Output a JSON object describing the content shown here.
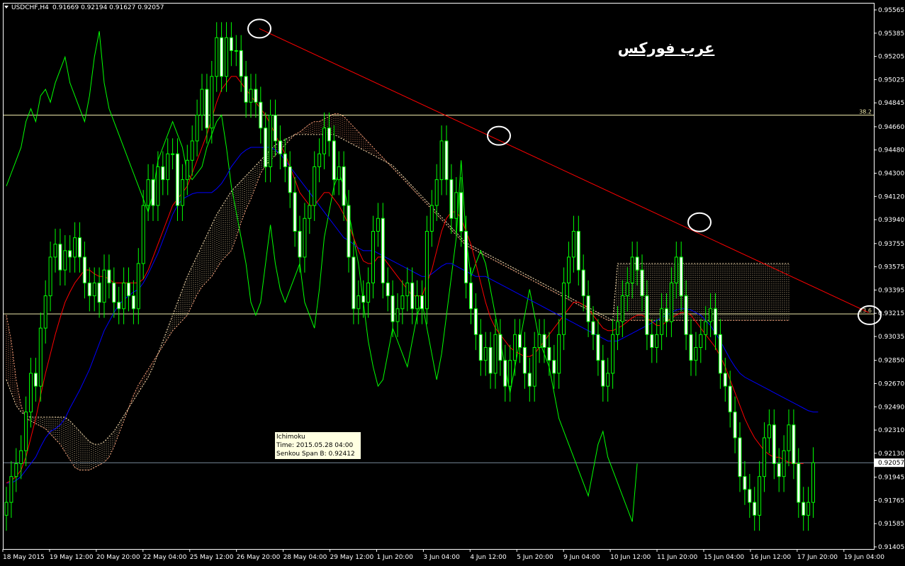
{
  "header": {
    "symbol_label": "USDCHF,H4",
    "ohlc": "0.91669 0.92194 0.91627 0.92057"
  },
  "brand_text": "عرب فوركس",
  "tooltip": {
    "title": "Ichimoku",
    "time_line": "Time: 2015.05.28 04:00",
    "value_line": "Senkou Span B: 0.92412"
  },
  "colors": {
    "background": "#000000",
    "frame": "#ffffff",
    "candles": "#00ff00",
    "tenkan": "#ff0000",
    "kijun": "#0000ff",
    "chikou": "#00ff00",
    "cloud_a": "#ffa07a",
    "cloud_b": "#ffe4b5",
    "trendline": "#ff0000",
    "fib_levels": "#eee8aa",
    "current_price_line": "#778899",
    "circles": "#ffffff"
  },
  "chart_data": {
    "type": "candlestick",
    "symbol": "USDCHF",
    "timeframe": "H4",
    "ohlc_last": {
      "open": 0.91669,
      "high": 0.92194,
      "low": 0.91627,
      "close": 0.92057
    },
    "current_price": 0.92057,
    "yticks": [
      "0.95565",
      "0.95385",
      "0.95205",
      "0.95025",
      "0.94845",
      "0.94660",
      "0.94480",
      "0.94300",
      "0.94120",
      "0.93940",
      "0.93755",
      "0.93575",
      "0.93395",
      "0.93215",
      "0.93035",
      "0.92850",
      "0.92670",
      "0.92490",
      "0.92310",
      "0.92130",
      "0.91945",
      "0.91765",
      "0.91585",
      "0.91405"
    ],
    "ylim": [
      0.91405,
      0.95565
    ],
    "xticks": [
      "18 May 2015",
      "19 May 12:00",
      "20 May 20:00",
      "22 May 04:00",
      "25 May 12:00",
      "26 May 20:00",
      "28 May 04:00",
      "29 May 12:00",
      "1 Jun 20:00",
      "3 Jun 04:00",
      "4 Jun 12:00",
      "5 Jun 20:00",
      "9 Jun 04:00",
      "10 Jun 12:00",
      "11 Jun 20:00",
      "15 Jun 04:00",
      "16 Jun 12:00",
      "17 Jun 20:00",
      "19 Jun 04:00"
    ],
    "fib_levels": [
      {
        "label": "38.2",
        "price": 0.9475
      },
      {
        "label": "23.6",
        "price": 0.9321
      }
    ],
    "indicators": [
      "Ichimoku",
      "Tenkan-sen",
      "Kijun-sen",
      "Chikou Span",
      "Senkou Span A",
      "Senkou Span B"
    ],
    "annotations": [
      "trendline",
      "touch circles"
    ],
    "series": {
      "close": [
        0.9175,
        0.9195,
        0.9205,
        0.9215,
        0.9245,
        0.9275,
        0.9265,
        0.931,
        0.9335,
        0.9365,
        0.9375,
        0.9355,
        0.937,
        0.9365,
        0.938,
        0.9365,
        0.9345,
        0.9335,
        0.9345,
        0.933,
        0.9355,
        0.9345,
        0.933,
        0.9325,
        0.9345,
        0.9335,
        0.9325,
        0.936,
        0.9405,
        0.9425,
        0.9405,
        0.9435,
        0.9425,
        0.9445,
        0.9445,
        0.9405,
        0.9425,
        0.944,
        0.9455,
        0.9475,
        0.9495,
        0.9465,
        0.9505,
        0.9535,
        0.9505,
        0.9535,
        0.9525,
        0.9525,
        0.9505,
        0.9485,
        0.9495,
        0.9485,
        0.9465,
        0.9435,
        0.9475,
        0.9455,
        0.9445,
        0.9435,
        0.9415,
        0.9385,
        0.9365,
        0.9395,
        0.9405,
        0.9435,
        0.9445,
        0.9465,
        0.9455,
        0.9425,
        0.9435,
        0.9405,
        0.9365,
        0.9325,
        0.9335,
        0.933,
        0.9345,
        0.9385,
        0.9395,
        0.9345,
        0.9335,
        0.9315,
        0.9325,
        0.9335,
        0.9345,
        0.9325,
        0.9335,
        0.9325,
        0.9385,
        0.9405,
        0.9425,
        0.9455,
        0.9425,
        0.9395,
        0.9415,
        0.9385,
        0.9345,
        0.9325,
        0.9305,
        0.9285,
        0.9295,
        0.9275,
        0.9305,
        0.9285,
        0.9265,
        0.9285,
        0.9305,
        0.9295,
        0.9275,
        0.9265,
        0.9295,
        0.9305,
        0.9295,
        0.9285,
        0.9275,
        0.9305,
        0.9345,
        0.9365,
        0.9385,
        0.9355,
        0.9335,
        0.9315,
        0.9305,
        0.9285,
        0.9265,
        0.9275,
        0.9305,
        0.9315,
        0.9335,
        0.9345,
        0.9365,
        0.9355,
        0.9335,
        0.9305,
        0.9295,
        0.9305,
        0.9325,
        0.9315,
        0.9345,
        0.9365,
        0.9335,
        0.9305,
        0.9285,
        0.9295,
        0.9305,
        0.9315,
        0.9325,
        0.9305,
        0.9275,
        0.9265,
        0.9245,
        0.9225,
        0.9195,
        0.9185,
        0.9175,
        0.9165,
        0.9195,
        0.9225,
        0.9235,
        0.9205,
        0.9195,
        0.9215,
        0.9235,
        0.9205,
        0.9175,
        0.9165,
        0.9175,
        0.92057
      ],
      "tenkan": [
        0.919,
        0.9192,
        0.9195,
        0.92,
        0.921,
        0.9225,
        0.924,
        0.9258,
        0.9275,
        0.929,
        0.9305,
        0.9318,
        0.933,
        0.9338,
        0.9345,
        0.935,
        0.9355,
        0.9355,
        0.9352,
        0.935,
        0.935,
        0.9348,
        0.9345,
        0.9345,
        0.9345,
        0.9345,
        0.9345,
        0.9345,
        0.9348,
        0.9355,
        0.9365,
        0.9375,
        0.9385,
        0.9395,
        0.9405,
        0.941,
        0.9415,
        0.942,
        0.943,
        0.944,
        0.945,
        0.946,
        0.9472,
        0.9485,
        0.9495,
        0.95,
        0.9505,
        0.9505,
        0.95,
        0.9495,
        0.949,
        0.9485,
        0.948,
        0.9475,
        0.9468,
        0.946,
        0.9452,
        0.9445,
        0.9435,
        0.9425,
        0.9415,
        0.941,
        0.9405,
        0.9405,
        0.941,
        0.9415,
        0.9415,
        0.941,
        0.9405,
        0.9398,
        0.939,
        0.938,
        0.937,
        0.9362,
        0.936,
        0.936,
        0.9365,
        0.9365,
        0.936,
        0.9355,
        0.935,
        0.9345,
        0.934,
        0.9335,
        0.9335,
        0.9335,
        0.9345,
        0.9355,
        0.937,
        0.9385,
        0.9395,
        0.94,
        0.94,
        0.9395,
        0.9385,
        0.9375,
        0.936,
        0.9345,
        0.933,
        0.9318,
        0.931,
        0.9305,
        0.93,
        0.9295,
        0.9292,
        0.929,
        0.9288,
        0.9288,
        0.929,
        0.9295,
        0.93,
        0.9305,
        0.931,
        0.9315,
        0.932,
        0.9325,
        0.933,
        0.933,
        0.9328,
        0.9325,
        0.932,
        0.9315,
        0.931,
        0.9308,
        0.9308,
        0.931,
        0.9312,
        0.9315,
        0.9318,
        0.932,
        0.932,
        0.9318,
        0.9315,
        0.9312,
        0.9312,
        0.9315,
        0.9318,
        0.932,
        0.9322,
        0.9322,
        0.932,
        0.9315,
        0.931,
        0.9305,
        0.93,
        0.9295,
        0.9288,
        0.928,
        0.927,
        0.926,
        0.925,
        0.924,
        0.9232,
        0.9225,
        0.922,
        0.9215,
        0.9212,
        0.921,
        0.921,
        0.9208,
        0.9206,
        0.9205,
        0.9205,
        0.9205
      ],
      "kijun": [
        0.919,
        0.919,
        0.9192,
        0.9195,
        0.92,
        0.9205,
        0.921,
        0.9218,
        0.9225,
        0.923,
        0.9232,
        0.9235,
        0.924,
        0.9248,
        0.9255,
        0.9262,
        0.927,
        0.9278,
        0.9288,
        0.9298,
        0.9308,
        0.9315,
        0.9322,
        0.9328,
        0.9332,
        0.9335,
        0.9338,
        0.934,
        0.9345,
        0.9352,
        0.936,
        0.9368,
        0.9378,
        0.9388,
        0.9398,
        0.9405,
        0.941,
        0.9412,
        0.9414,
        0.9415,
        0.9415,
        0.9415,
        0.9415,
        0.9418,
        0.9422,
        0.9428,
        0.9435,
        0.944,
        0.9445,
        0.9448,
        0.945,
        0.945,
        0.945,
        0.945,
        0.945,
        0.9448,
        0.9445,
        0.944,
        0.9435,
        0.943,
        0.9425,
        0.942,
        0.9415,
        0.941,
        0.9405,
        0.94,
        0.9395,
        0.939,
        0.9385,
        0.938,
        0.9378,
        0.9375,
        0.9372,
        0.937,
        0.937,
        0.937,
        0.9368,
        0.9366,
        0.9364,
        0.9362,
        0.936,
        0.9358,
        0.9356,
        0.9354,
        0.9352,
        0.935,
        0.935,
        0.9352,
        0.9355,
        0.9358,
        0.936,
        0.936,
        0.9358,
        0.9356,
        0.9354,
        0.9352,
        0.935,
        0.935,
        0.935,
        0.9348,
        0.9346,
        0.9344,
        0.9342,
        0.934,
        0.9338,
        0.9336,
        0.9334,
        0.9332,
        0.933,
        0.9328,
        0.9326,
        0.9324,
        0.9322,
        0.932,
        0.9318,
        0.9316,
        0.9314,
        0.9312,
        0.931,
        0.9308,
        0.9306,
        0.9304,
        0.9302,
        0.93,
        0.93,
        0.93,
        0.9302,
        0.9304,
        0.9306,
        0.9308,
        0.931,
        0.9312,
        0.9314,
        0.9316,
        0.9318,
        0.932,
        0.9322,
        0.9324,
        0.9325,
        0.9325,
        0.9324,
        0.9322,
        0.932,
        0.9316,
        0.9312,
        0.9306,
        0.93,
        0.9293,
        0.9286,
        0.928,
        0.9275,
        0.9272,
        0.927,
        0.9268,
        0.9266,
        0.9264,
        0.9262,
        0.926,
        0.9258,
        0.9256,
        0.9254,
        0.9252,
        0.925,
        0.9248,
        0.9246,
        0.9245,
        0.9245
      ],
      "chikou": [
        0.942,
        0.943,
        0.944,
        0.945,
        0.947,
        0.948,
        0.947,
        0.949,
        0.9495,
        0.9485,
        0.95,
        0.951,
        0.952,
        0.95,
        0.949,
        0.948,
        0.947,
        0.949,
        0.952,
        0.954,
        0.95,
        0.948,
        0.947,
        0.946,
        0.945,
        0.944,
        0.943,
        0.942,
        0.941,
        0.94,
        0.9415,
        0.944,
        0.945,
        0.946,
        0.947,
        0.946,
        0.945,
        0.943,
        0.9425,
        0.943,
        0.9435,
        0.945,
        0.946,
        0.947,
        0.9475,
        0.945,
        0.942,
        0.94,
        0.938,
        0.936,
        0.933,
        0.932,
        0.933,
        0.936,
        0.939,
        0.936,
        0.934,
        0.933,
        0.934,
        0.935,
        0.936,
        0.933,
        0.932,
        0.931,
        0.934,
        0.938,
        0.94,
        0.942,
        0.943,
        0.942,
        0.94,
        0.938,
        0.936,
        0.933,
        0.93,
        0.928,
        0.9265,
        0.927,
        0.929,
        0.931,
        0.93,
        0.929,
        0.928,
        0.93,
        0.932,
        0.933,
        0.931,
        0.929,
        0.927,
        0.929,
        0.932,
        0.935,
        0.938,
        0.944,
        0.938,
        0.935,
        0.936,
        0.937,
        0.936,
        0.934,
        0.932,
        0.93,
        0.928,
        0.926,
        0.928,
        0.93,
        0.932,
        0.934,
        0.932,
        0.93,
        0.929,
        0.928,
        0.926,
        0.924,
        0.923,
        0.922,
        0.921,
        0.92,
        0.919,
        0.918,
        0.92,
        0.922,
        0.923,
        0.921,
        0.92,
        0.919,
        0.918,
        0.917,
        0.916,
        0.9205
      ],
      "senkou_a": [
        0.932,
        0.93,
        0.927,
        0.925,
        0.924,
        0.9238,
        0.9236,
        0.9234,
        0.9232,
        0.9228,
        0.9224,
        0.922,
        0.9214,
        0.9208,
        0.9202,
        0.92,
        0.92,
        0.92,
        0.9202,
        0.9204,
        0.9206,
        0.921,
        0.9218,
        0.9228,
        0.9238,
        0.9248,
        0.9258,
        0.9266,
        0.9272,
        0.9278,
        0.9284,
        0.929,
        0.9296,
        0.9302,
        0.9308,
        0.9312,
        0.9316,
        0.932,
        0.9328,
        0.9336,
        0.9342,
        0.9346,
        0.935,
        0.9356,
        0.9362,
        0.9366,
        0.937,
        0.938,
        0.9392,
        0.9402,
        0.941,
        0.942,
        0.943,
        0.9436,
        0.944,
        0.9444,
        0.9448,
        0.9452,
        0.9456,
        0.946,
        0.9462,
        0.9465,
        0.9468,
        0.947,
        0.947,
        0.9472,
        0.9474,
        0.9476,
        0.9476,
        0.9474,
        0.947,
        0.9466,
        0.9462,
        0.9458,
        0.9454,
        0.945,
        0.9446,
        0.9442,
        0.9438,
        0.9434,
        0.943,
        0.9426,
        0.9422,
        0.9418,
        0.9414,
        0.941,
        0.9406,
        0.9402,
        0.9398,
        0.9394,
        0.939,
        0.9386,
        0.9382,
        0.9378,
        0.9374,
        0.9372,
        0.937,
        0.9368,
        0.9366,
        0.9364,
        0.9362,
        0.936,
        0.9358,
        0.9356,
        0.9354,
        0.9352,
        0.935,
        0.9348,
        0.9346,
        0.9344,
        0.9342,
        0.934,
        0.9338,
        0.9336,
        0.9334,
        0.9332,
        0.933,
        0.9328,
        0.9326,
        0.9324,
        0.9322,
        0.932,
        0.9318,
        0.9316,
        0.9316,
        0.9316,
        0.9316,
        0.9316,
        0.9316,
        0.9316,
        0.9316,
        0.9316,
        0.9316,
        0.9316,
        0.9316,
        0.9316,
        0.9316,
        0.9316,
        0.9316,
        0.9316,
        0.9316,
        0.9316,
        0.9316,
        0.9316,
        0.9316,
        0.9316,
        0.9316,
        0.9316,
        0.9316,
        0.9316,
        0.9316,
        0.9316,
        0.9316,
        0.9316,
        0.9316,
        0.9316,
        0.9316,
        0.9316,
        0.9316,
        0.9316,
        0.9316
      ],
      "senkou_b": [
        0.927,
        0.926,
        0.925,
        0.9245,
        0.9242,
        0.9241,
        0.9241,
        0.9241,
        0.9241,
        0.9241,
        0.9241,
        0.9241,
        0.9241,
        0.9238,
        0.9234,
        0.923,
        0.9226,
        0.9222,
        0.922,
        0.922,
        0.9222,
        0.9226,
        0.923,
        0.9236,
        0.9242,
        0.9248,
        0.9254,
        0.926,
        0.9266,
        0.9272,
        0.928,
        0.929,
        0.93,
        0.931,
        0.932,
        0.933,
        0.934,
        0.935,
        0.9358,
        0.9366,
        0.9374,
        0.9382,
        0.939,
        0.9398,
        0.9404,
        0.941,
        0.9416,
        0.942,
        0.9424,
        0.9428,
        0.9432,
        0.9436,
        0.944,
        0.9444,
        0.9448,
        0.9452,
        0.9454,
        0.9456,
        0.9458,
        0.946,
        0.946,
        0.946,
        0.946,
        0.946,
        0.946,
        0.946,
        0.946,
        0.946,
        0.9458,
        0.9456,
        0.9454,
        0.9452,
        0.945,
        0.9448,
        0.9446,
        0.9444,
        0.9442,
        0.944,
        0.9438,
        0.9436,
        0.9432,
        0.9428,
        0.9424,
        0.942,
        0.9416,
        0.9412,
        0.9408,
        0.9404,
        0.94,
        0.9396,
        0.9392,
        0.9388,
        0.9384,
        0.938,
        0.9376,
        0.9374,
        0.9372,
        0.937,
        0.9368,
        0.9366,
        0.9364,
        0.9362,
        0.936,
        0.9358,
        0.9356,
        0.9354,
        0.9352,
        0.935,
        0.9348,
        0.9346,
        0.9344,
        0.9342,
        0.934,
        0.9338,
        0.9336,
        0.9334,
        0.9332,
        0.933,
        0.9328,
        0.9326,
        0.9324,
        0.9322,
        0.932,
        0.9318,
        0.9316,
        0.936,
        0.936,
        0.936,
        0.936,
        0.936,
        0.936,
        0.936,
        0.936,
        0.936,
        0.936,
        0.936,
        0.936,
        0.936,
        0.936,
        0.936,
        0.936,
        0.936,
        0.936,
        0.936,
        0.936,
        0.936,
        0.936,
        0.936,
        0.936,
        0.936,
        0.936,
        0.936,
        0.936,
        0.936,
        0.936,
        0.936,
        0.936,
        0.936,
        0.936,
        0.936,
        0.936,
        0.936,
        0.936
      ]
    }
  }
}
